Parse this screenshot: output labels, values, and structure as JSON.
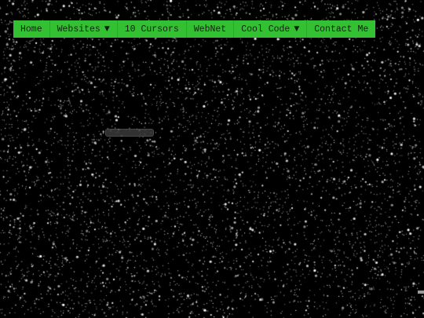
{
  "background_color": "#000000",
  "nav_color": "#33c033",
  "nav": {
    "items": [
      {
        "label": "Home",
        "dropdown": false
      },
      {
        "label": "Websites",
        "dropdown": true
      },
      {
        "label": "10 Cursors",
        "dropdown": false
      },
      {
        "label": "WebNet",
        "dropdown": false
      },
      {
        "label": "Cool Code",
        "dropdown": true
      },
      {
        "label": "Contact Me",
        "dropdown": false
      }
    ],
    "caret_glyph": "▼"
  }
}
